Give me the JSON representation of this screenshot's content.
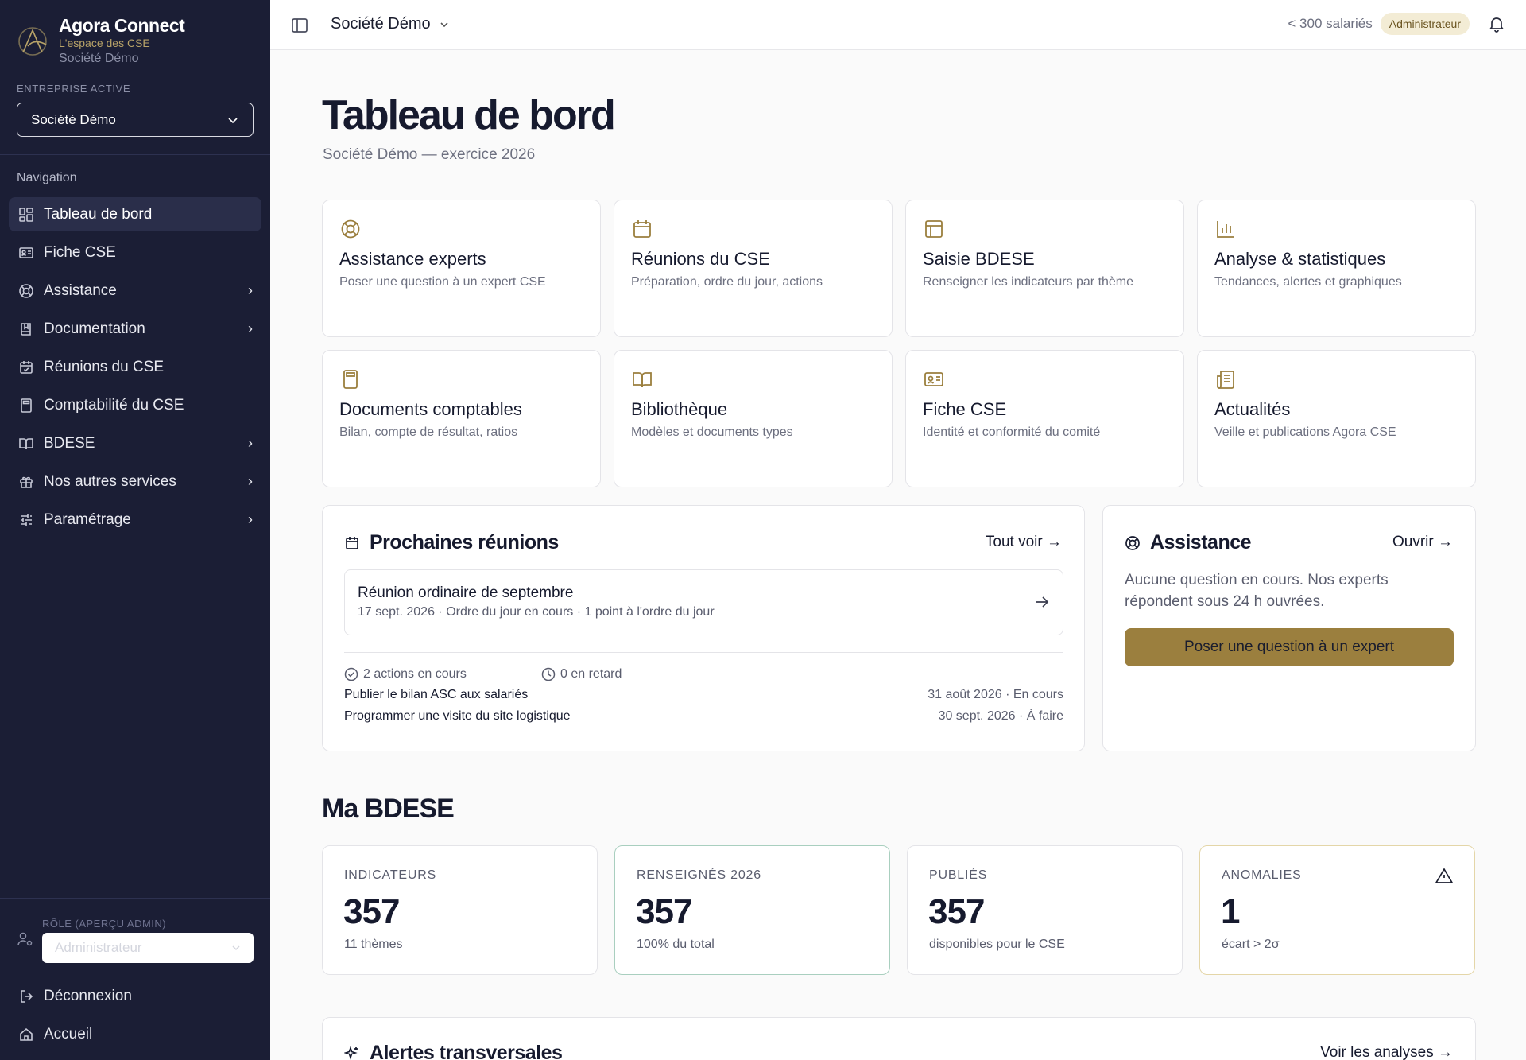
{
  "brand": {
    "name": "Agora Connect",
    "tagline": "L'espace des CSE",
    "company": "Société Démo"
  },
  "sidebar": {
    "entreprise_label": "Entreprise active",
    "entreprise_value": "Société Démo",
    "nav_title": "Navigation",
    "items": [
      {
        "label": "Tableau de bord",
        "icon": "dashboard-icon"
      },
      {
        "label": "Fiche CSE",
        "icon": "id-card-icon"
      },
      {
        "label": "Assistance",
        "icon": "lifebuoy-icon"
      },
      {
        "label": "Documentation",
        "icon": "book-icon"
      },
      {
        "label": "Réunions du CSE",
        "icon": "calendar-check-icon"
      },
      {
        "label": "Comptabilité du CSE",
        "icon": "calculator-icon"
      },
      {
        "label": "BDESE",
        "icon": "open-book-icon"
      },
      {
        "label": "Nos autres services",
        "icon": "gift-icon"
      },
      {
        "label": "Paramétrage",
        "icon": "sliders-icon"
      }
    ],
    "role_label": "Rôle (aperçu admin)",
    "role_value": "Administrateur",
    "logout": "Déconnexion",
    "home": "Accueil"
  },
  "topbar": {
    "company": "Société Démo",
    "employees": "< 300 salariés",
    "role_badge": "Administrateur"
  },
  "page": {
    "title": "Tableau de bord",
    "subtitle": "Société Démo — exercice 2026"
  },
  "tiles": [
    {
      "title": "Assistance experts",
      "sub": "Poser une question à un expert CSE",
      "icon": "lifebuoy-icon"
    },
    {
      "title": "Réunions du CSE",
      "sub": "Préparation, ordre du jour, actions",
      "icon": "calendar-icon"
    },
    {
      "title": "Saisie BDESE",
      "sub": "Renseigner les indicateurs par thème",
      "icon": "table-icon"
    },
    {
      "title": "Analyse & statistiques",
      "sub": "Tendances, alertes et graphiques",
      "icon": "bar-chart-icon"
    },
    {
      "title": "Documents comptables",
      "sub": "Bilan, compte de résultat, ratios",
      "icon": "calculator-icon"
    },
    {
      "title": "Bibliothèque",
      "sub": "Modèles et documents types",
      "icon": "open-book-icon"
    },
    {
      "title": "Fiche CSE",
      "sub": "Identité et conformité du comité",
      "icon": "id-card-icon"
    },
    {
      "title": "Actualités",
      "sub": "Veille et publications Agora CSE",
      "icon": "newspaper-icon"
    }
  ],
  "meetings": {
    "title": "Prochaines réunions",
    "link": "Tout voir →",
    "next": {
      "title": "Réunion ordinaire de septembre",
      "sub": "17 sept. 2026 · Ordre du jour en cours · 1 point à l'ordre du jour"
    },
    "actions_count": "2 actions en cours",
    "late_count": "0 en retard",
    "actions": [
      {
        "label": "Publier le bilan ASC aux salariés",
        "meta": "31 août 2026 · En cours"
      },
      {
        "label": "Programmer une visite du site logistique",
        "meta": "30 sept. 2026 · À faire"
      }
    ]
  },
  "assistance": {
    "title": "Assistance",
    "link": "Ouvrir →",
    "text": "Aucune question en cours. Nos experts répondent sous 24 h ouvrées.",
    "button": "Poser une question à un expert"
  },
  "bdese": {
    "title": "Ma BDESE",
    "kpis": [
      {
        "label": "Indicateurs",
        "value": "357",
        "sub": "11 thèmes"
      },
      {
        "label": "Renseignés 2026",
        "value": "357",
        "sub": "100% du total"
      },
      {
        "label": "Publiés",
        "value": "357",
        "sub": "disponibles pour le CSE"
      },
      {
        "label": "Anomalies",
        "value": "1",
        "sub": "écart > 2σ"
      }
    ]
  },
  "alerts": {
    "title": "Alertes transversales",
    "link": "Voir les analyses →"
  },
  "colors": {
    "sidebar_bg": "#1b1e35",
    "accent": "#9b7f3e",
    "badge_bg": "#f3ecd5"
  }
}
